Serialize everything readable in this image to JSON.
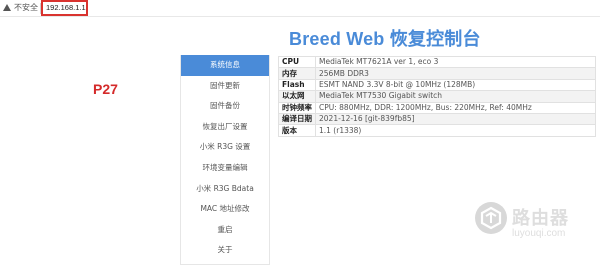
{
  "browser": {
    "security_label": "不安全",
    "url": "192.168.1.1"
  },
  "page": {
    "title": "Breed Web 恢复控制台"
  },
  "annotation": {
    "label": "P27",
    "color": "#d42a2a"
  },
  "sidebar": {
    "active_index": 0,
    "items": [
      {
        "label": "系统信息"
      },
      {
        "label": "固件更新"
      },
      {
        "label": "固件备份"
      },
      {
        "label": "恢复出厂设置"
      },
      {
        "label": "小米 R3G 设置"
      },
      {
        "label": "环境变量编辑"
      },
      {
        "label": "小米 R3G Bdata"
      },
      {
        "label": "MAC 地址修改"
      },
      {
        "label": "重启"
      },
      {
        "label": "关于"
      }
    ]
  },
  "system_info": {
    "rows": [
      {
        "key": "CPU",
        "value": "MediaTek MT7621A ver 1, eco 3"
      },
      {
        "key": "内存",
        "value": "256MB DDR3"
      },
      {
        "key": "Flash",
        "value": "ESMT NAND 3.3V 8-bit @ 10MHz (128MB)"
      },
      {
        "key": "以太网",
        "value": "MediaTek MT7530 Gigabit switch"
      },
      {
        "key": "时钟频率",
        "value": "CPU: 880MHz, DDR: 1200MHz, Bus: 220MHz, Ref: 40MHz"
      },
      {
        "key": "编译日期",
        "value": "2021-12-16 [git-839fb85]"
      },
      {
        "key": "版本",
        "value": "1.1 (r1338)"
      }
    ]
  },
  "watermark": {
    "text": "路由器",
    "sub": "luyouqi.com"
  },
  "colors": {
    "accent": "#4a8bd8",
    "url_highlight": "#d9332f"
  }
}
